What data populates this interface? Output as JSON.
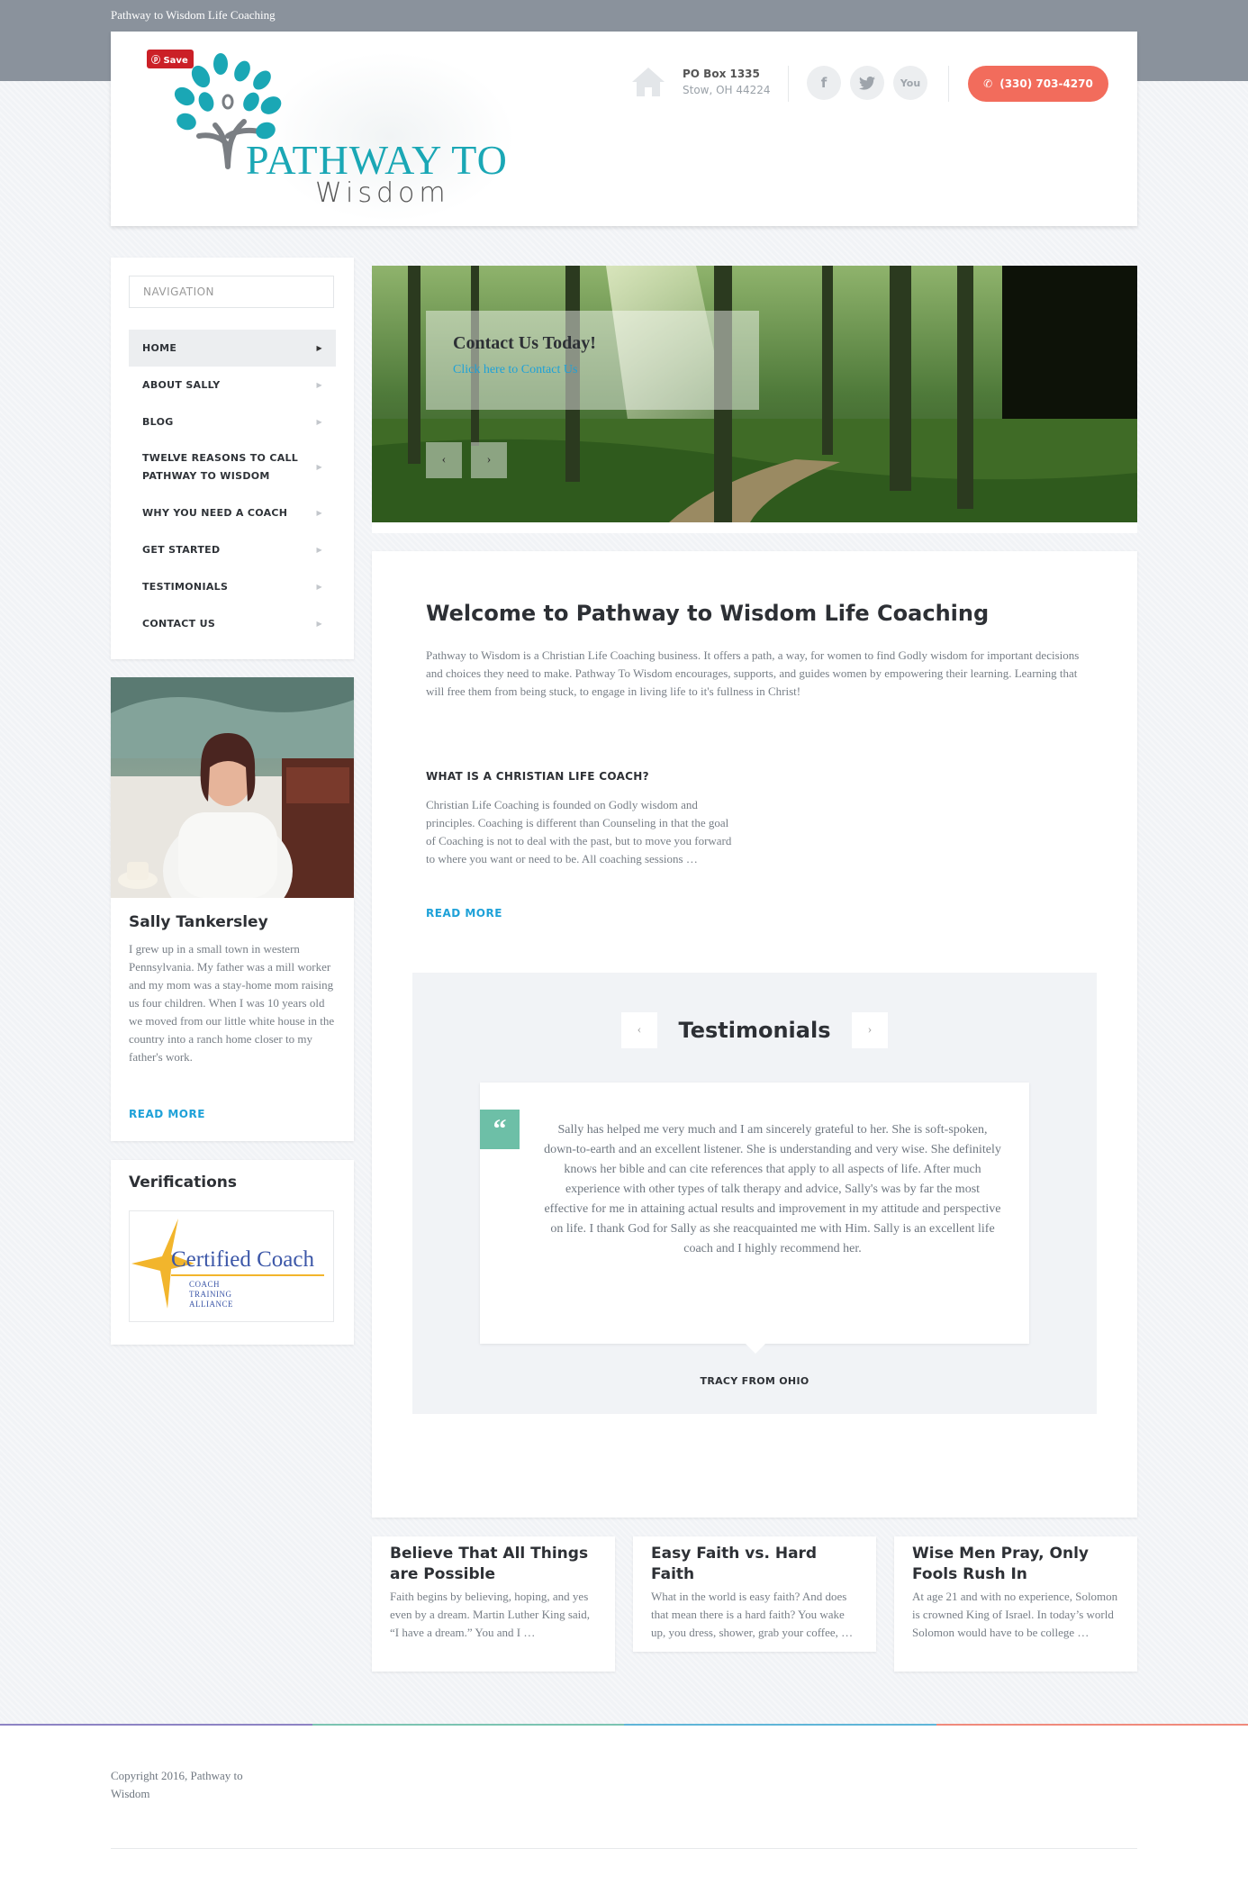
{
  "site": {
    "top_title": "Pathway to Wisdom Life Coaching",
    "save_label": "Save",
    "logo_line1": "PATHWAY TO",
    "logo_line2": "Wisdom",
    "address_line1": "PO Box 1335",
    "address_line2": "Stow, OH 44224",
    "phone": "(330) 703-4270",
    "social_icons": [
      "facebook-icon",
      "twitter-icon",
      "youtube-icon"
    ],
    "colors": {
      "accent": "#1ea1d8",
      "phone_button": "#f26c5c",
      "logo_teal": "#1aa7b5",
      "quote_mark": "#6dbfa7"
    }
  },
  "nav": {
    "heading": "NAVIGATION",
    "items": [
      {
        "label": "HOME",
        "active": true
      },
      {
        "label": "ABOUT SALLY"
      },
      {
        "label": "BLOG"
      },
      {
        "label": "TWELVE REASONS TO CALL PATHWAY TO WISDOM"
      },
      {
        "label": "WHY YOU NEED A COACH"
      },
      {
        "label": "GET STARTED"
      },
      {
        "label": "TESTIMONIALS"
      },
      {
        "label": "CONTACT US"
      }
    ]
  },
  "profile": {
    "name": "Sally Tankersley",
    "bio": "I grew up in a small town in western Pennsylvania. My father was a mill worker and my mom was a stay-home mom raising us four children. When I was 10 years old we moved from our little white house in the country into a ranch home closer to my father's work.",
    "read_more": "READ MORE"
  },
  "verifications": {
    "title": "Verifications",
    "badge_title": "Certified Coach",
    "badge_line1": "COACH",
    "badge_line2": "TRAINING",
    "badge_line3": "ALLIANCE"
  },
  "slider": {
    "caption_title": "Contact Us Today!",
    "caption_link": "Click here to Contact Us",
    "prev": "‹",
    "next": "›"
  },
  "main": {
    "title": "Welcome to Pathway to Wisdom Life Coaching",
    "intro": "Pathway to Wisdom is a Christian Life Coaching business. It offers a path, a way, for women to find Godly wisdom for important decisions and choices they need to make. Pathway To Wisdom encourages, supports, and guides women by empowering their learning. Learning that will free them from being stuck, to engage in living life to it's fullness in Christ!",
    "subhead": "WHAT IS A CHRISTIAN LIFE COACH?",
    "coach_text": "Christian Life Coaching is founded on Godly wisdom and principles. Coaching is different than Counseling in that the goal of Coaching is not to deal with the past, but to move you forward to where you want or need to be. All coaching sessions …",
    "read_more": "READ MORE"
  },
  "testimonials": {
    "title": "Testimonials",
    "prev": "‹",
    "next": "›",
    "quote_mark": "“",
    "quote": "Sally has helped me very much and I am sincerely grateful to her. She is soft-spoken, down-to-earth and an excellent listener. She is understanding and very wise. She definitely knows her bible and can cite references that apply to all aspects of life. After much experience with other types of talk therapy and advice, Sally's was by far the most effective for me in attaining actual results and improvement in my attitude and perspective on life. I thank God for Sally as she reacquainted me with Him. Sally is an excellent life coach and I highly recommend her.",
    "author": "TRACY FROM OHIO"
  },
  "posts": [
    {
      "title": "Believe That All Things are Possible",
      "excerpt": "Faith begins by believing, hoping, and yes even by a dream.  Martin Luther King said, “I have a dream.”  You and I …"
    },
    {
      "title": "Easy Faith vs. Hard Faith",
      "excerpt": "What in the world is easy faith? And does that mean there is a hard faith? You wake up, you dress, shower, grab your coffee, …"
    },
    {
      "title": "Wise Men Pray, Only Fools Rush In",
      "excerpt": "At age 21 and with no experience, Solomon is crowned King of Israel.  In today’s world Solomon would have to be college …"
    }
  ],
  "footer": {
    "copyright": "Copyright 2016, Pathway to Wisdom",
    "line_colors": [
      "#8d83c4",
      "#7bc4b2",
      "#5fb5d8",
      "#f08a7c"
    ]
  }
}
